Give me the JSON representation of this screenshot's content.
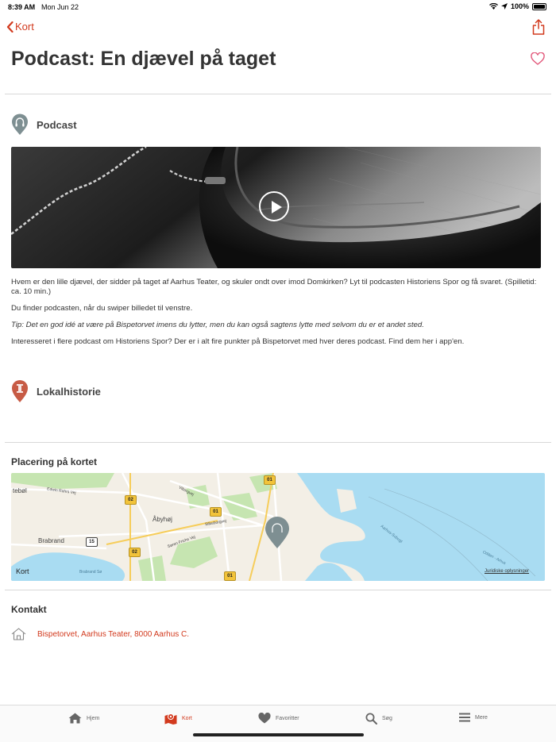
{
  "status": {
    "time": "8:39 AM",
    "date": "Mon Jun 22",
    "battery": "100%"
  },
  "nav": {
    "back_label": "Kort"
  },
  "page": {
    "title": "Podcast: En djævel på taget"
  },
  "sections": {
    "podcast_label": "Podcast",
    "local_label": "Lokalhistorie"
  },
  "description": {
    "p1": "Hvem er den lille djævel, der sidder på taget af Aarhus Teater, og skuler ondt over imod Domkirken? Lyt til podcasten Historiens Spor og få svaret. (Spilletid: ca. 10 min.)",
    "p2": "Du finder podcasten, når du swiper billedet til venstre.",
    "p3": "Tip: Det en god idé at være på Bispetorvet imens du lytter, men du kan også sagtens lytte med selvom du er et andet sted.",
    "p4": "Interesseret i flere podcast om Historiens Spor? Der er i alt fire punkter på Bispetorvet med hver deres podcast. Find dem her i app'en."
  },
  "map": {
    "section_title": "Placering på kortet",
    "labels": {
      "tebol": "tebøl",
      "edwin": "Edwin Rahrs Vej",
      "abyhoj": "Åbyhøj",
      "brabrand": "Brabrand",
      "brabrand_so": "Brabrand Sø",
      "viborgvej": "Viborgvej",
      "silkeborgvej": "Silkeborgvej",
      "soren": "Søren Frichs Vej",
      "aarhus_sobugt": "Aarhus-Sobugt",
      "odden": "Odden - Arhus",
      "apple_maps": "Kort",
      "legal": "Juridiske oplysninger"
    },
    "badges": {
      "b01": "01",
      "b02": "02",
      "b15": "15"
    },
    "colors": {
      "land": "#f3efe6",
      "water": "#a9dcf2",
      "park": "#c6e5b1",
      "pin": "#7e8f92"
    }
  },
  "contact": {
    "title": "Kontakt",
    "address": "Bispetorvet, Aarhus Teater, 8000 Aarhus C."
  },
  "tabs": [
    {
      "label": "Hjem",
      "icon": "home-icon"
    },
    {
      "label": "Kort",
      "icon": "map-icon"
    },
    {
      "label": "Favoritter",
      "icon": "heart-icon"
    },
    {
      "label": "Søg",
      "icon": "search-icon"
    },
    {
      "label": "Mere",
      "icon": "menu-icon"
    }
  ],
  "theme": {
    "accent": "#d23a1e",
    "podcast_pin": "#7e8f92",
    "history_pin": "#c75b45"
  }
}
